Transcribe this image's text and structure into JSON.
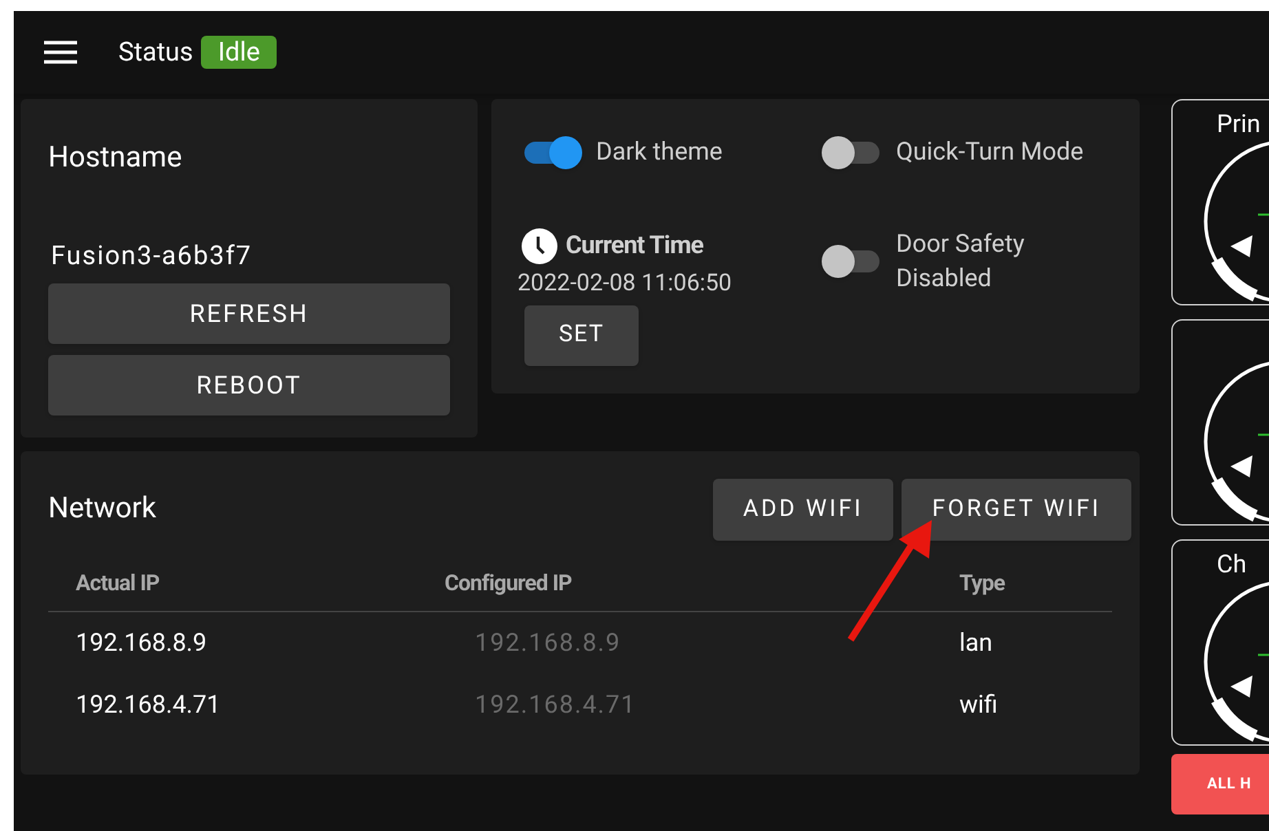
{
  "header": {
    "status_label": "Status",
    "status_badge": "Idle"
  },
  "hostname": {
    "title": "Hostname",
    "value": "Fusion3-a6b3f7",
    "buttons": [
      "REFRESH",
      "REBOOT"
    ]
  },
  "settings": {
    "toggles": [
      {
        "label": "Dark theme",
        "on": true
      },
      {
        "label": "Quick-Turn Mode",
        "on": false
      },
      {
        "label": "Door Safety Disabled",
        "on": false
      }
    ],
    "time": {
      "title": "Current Time",
      "value": "2022-02-08 11:06:50",
      "button": "SET"
    }
  },
  "network": {
    "title": "Network",
    "buttons": [
      "ADD WIFI",
      "FORGET WIFI"
    ],
    "columns": [
      "Actual IP",
      "Configured IP",
      "Type"
    ],
    "rows": [
      {
        "actual_ip": "192.168.8.9",
        "configured_ip": "192.168.8.9",
        "type": "lan"
      },
      {
        "actual_ip": "192.168.4.71",
        "configured_ip": "192.168.4.71",
        "type": "wifi"
      }
    ]
  },
  "gauges": [
    {
      "kind": "titled",
      "title": "Prin"
    },
    {
      "kind": "plain"
    },
    {
      "kind": "titled",
      "title": "Ch"
    }
  ],
  "gauge_button": "ALL H"
}
